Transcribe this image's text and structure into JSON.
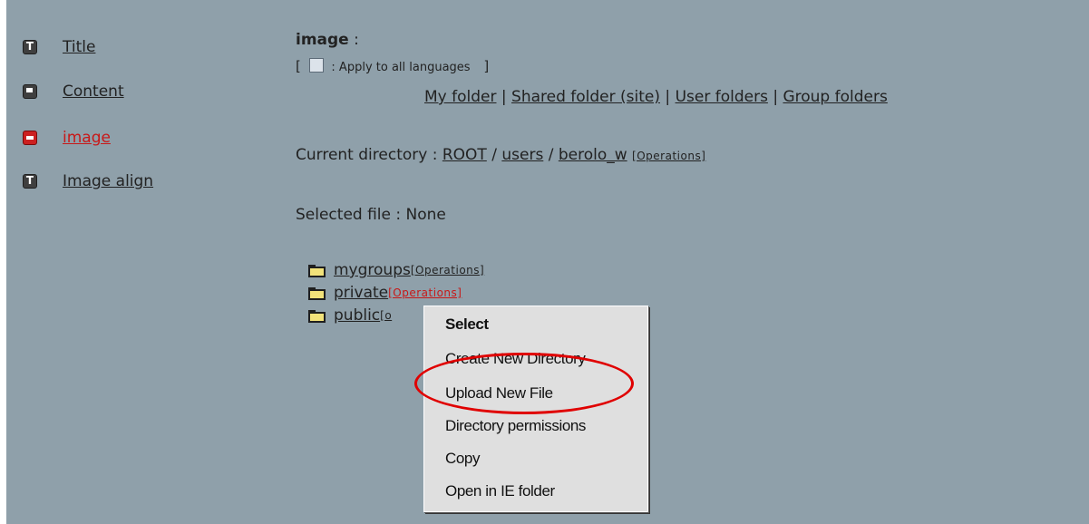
{
  "sidebar": {
    "items": [
      {
        "label": "Title",
        "icon": "text-type-icon"
      },
      {
        "label": "Content",
        "icon": "content-type-icon"
      },
      {
        "label": "image",
        "icon": "image-type-icon"
      },
      {
        "label": "Image align",
        "icon": "text-type-icon"
      }
    ]
  },
  "field": {
    "name": "image",
    "colon": ":",
    "bracket_open": "[",
    "bracket_close": "]",
    "apply_all_label": ": Apply to all languages"
  },
  "folders_nav": {
    "my_folder": "My folder",
    "shared_folder": "Shared folder (site)",
    "user_folders": "User folders",
    "group_folders": "Group folders",
    "separator": "|"
  },
  "current_dir": {
    "label": "Current directory :",
    "root": "ROOT",
    "users": "users",
    "user": "berolo_w",
    "slash": "/",
    "operations": "[Operations]"
  },
  "selected_file": {
    "text": "Selected file : None"
  },
  "folders": [
    {
      "name": "mygroups",
      "operations": "[Operations]"
    },
    {
      "name": "private",
      "operations": "[Operations]"
    },
    {
      "name": "public",
      "operations": "[o"
    }
  ],
  "context_menu": {
    "items": [
      "Select",
      "Create New Directory",
      "Upload New File",
      "Directory permissions",
      "Copy",
      "Open in IE folder"
    ]
  },
  "colors": {
    "background": "#8fa0aa",
    "active_red": "#c81818",
    "highlight_circle": "#e00000"
  }
}
